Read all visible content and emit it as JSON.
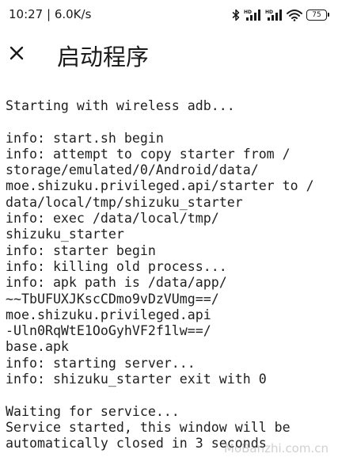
{
  "status_bar": {
    "time": "10:27 | 6.0K/s",
    "network_badge_1": "HD",
    "network_badge_2": "HD",
    "battery": "75",
    "icons": [
      "bluetooth-icon",
      "signal-hd-icon",
      "signal-hd-icon",
      "wifi-icon",
      "battery-icon"
    ]
  },
  "app_bar": {
    "close_icon": "close-icon",
    "title": "启动程序"
  },
  "log": {
    "lines": [
      "Starting with wireless adb...",
      "",
      "info: start.sh begin",
      "info: attempt to copy starter from /",
      "storage/emulated/0/Android/data/",
      "moe.shizuku.privileged.api/starter to /",
      "data/local/tmp/shizuku_starter",
      "info: exec /data/local/tmp/",
      "shizuku_starter",
      "info: starter begin",
      "info: killing old process...",
      "info: apk path is /data/app/",
      "~~TbUFUXJKscCDmo9vDzVUmg==/",
      "moe.shizuku.privileged.api",
      "-Uln0RqWtE1OoGyhVF2f1lw==/",
      "base.apk",
      "info: starting server...",
      "info: shizuku_starter exit with 0",
      "",
      "Waiting for service...",
      "Service started, this window will be",
      "automatically closed in 3 seconds"
    ]
  },
  "watermark": "MoBanzhi.com.cn"
}
